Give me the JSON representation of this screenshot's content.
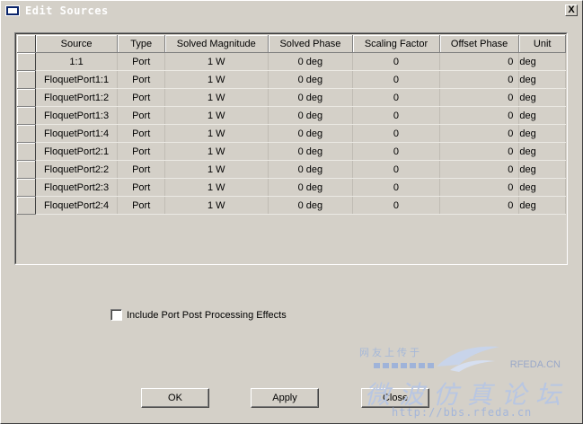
{
  "window": {
    "title": "Edit Sources",
    "close_glyph": "X"
  },
  "table": {
    "headers": [
      "Source",
      "Type",
      "Solved Magnitude",
      "Solved Phase",
      "Scaling Factor",
      "Offset Phase",
      "Unit"
    ],
    "rows": [
      [
        "1:1",
        "Port",
        "1 W",
        "0 deg",
        "0",
        "0",
        "deg"
      ],
      [
        "FloquetPort1:1",
        "Port",
        "1 W",
        "0 deg",
        "0",
        "0",
        "deg"
      ],
      [
        "FloquetPort1:2",
        "Port",
        "1 W",
        "0 deg",
        "0",
        "0",
        "deg"
      ],
      [
        "FloquetPort1:3",
        "Port",
        "1 W",
        "0 deg",
        "0",
        "0",
        "deg"
      ],
      [
        "FloquetPort1:4",
        "Port",
        "1 W",
        "0 deg",
        "0",
        "0",
        "deg"
      ],
      [
        "FloquetPort2:1",
        "Port",
        "1 W",
        "0 deg",
        "0",
        "0",
        "deg"
      ],
      [
        "FloquetPort2:2",
        "Port",
        "1 W",
        "0 deg",
        "0",
        "0",
        "deg"
      ],
      [
        "FloquetPort2:3",
        "Port",
        "1 W",
        "0 deg",
        "0",
        "0",
        "deg"
      ],
      [
        "FloquetPort2:4",
        "Port",
        "1 W",
        "0 deg",
        "0",
        "0",
        "deg"
      ]
    ]
  },
  "options": {
    "include_post_processing_label": "Include Port Post Processing Effects",
    "include_post_processing_checked": false
  },
  "buttons": {
    "ok": "OK",
    "apply": "Apply",
    "close": "Close"
  },
  "watermark": {
    "top_text": "网友上传于",
    "brand": "RFEDA.CN",
    "big_text": "微波仿真论坛",
    "url": "http://bbs.rfeda.cn"
  },
  "colors": {
    "face": "#d4d0c8",
    "title_text": "#ffffff",
    "watermark": "#b8c6e2"
  }
}
